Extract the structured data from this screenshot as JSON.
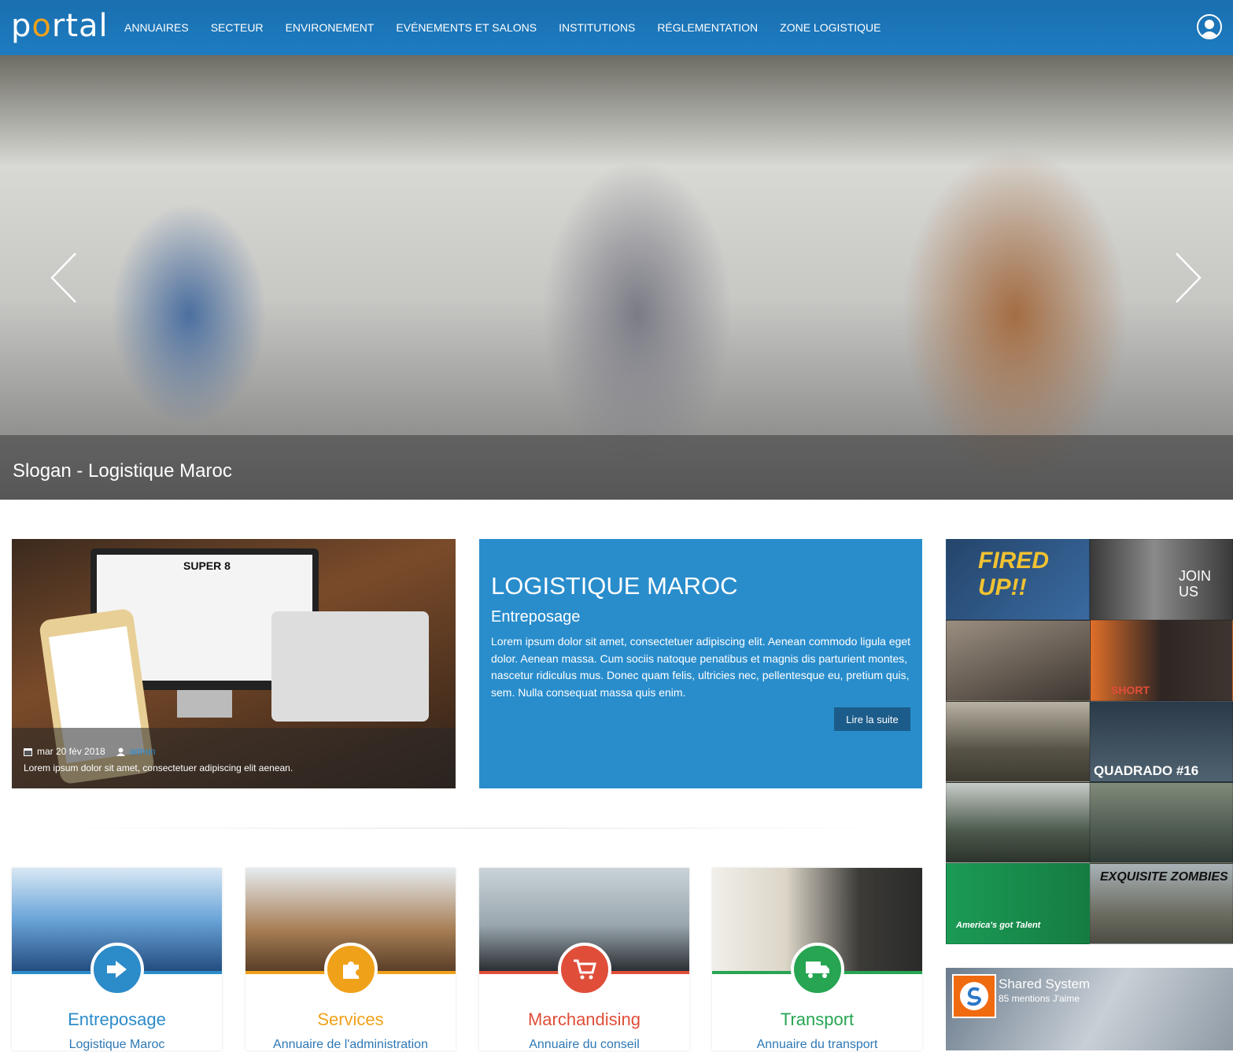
{
  "header": {
    "logo": "portal",
    "nav": [
      "ANNUAIRES",
      "SECTEUR",
      "ENVIRONEMENT",
      "EVÉNEMENTS ET SALONS",
      "INSTITUTIONS",
      "RÉGLEMENTATION",
      "ZONE LOGISTIQUE"
    ]
  },
  "hero": {
    "caption": "Slogan - Logistique Maroc"
  },
  "article": {
    "date": "mar 20 fév 2018",
    "author": "admin",
    "excerpt": "Lorem ipsum dolor sit amet, consectetuer adipiscing elit aenean.",
    "screen_title": "SUPER 8"
  },
  "feature": {
    "title": "LOGISTIQUE MAROC",
    "subtitle": "Entreposage",
    "body": "Lorem ipsum dolor sit amet, consectetuer adipiscing elit. Aenean commodo ligula eget dolor. Aenean massa. Cum sociis natoque penatibus et magnis dis parturient montes, nascetur ridiculus mus. Donec quam felis, ultricies nec, pellentesque eu, pretium quis, sem. Nulla consequat massa quis enim.",
    "button": "Lire la suite"
  },
  "services": [
    {
      "title": "Entreposage",
      "sub": "Logistique Maroc",
      "color": "#2c8bc9",
      "icon": "sign-in-icon"
    },
    {
      "title": "Services",
      "sub": "Annuaire de l'administration",
      "color": "#f0a11a",
      "icon": "puzzle-icon"
    },
    {
      "title": "Marchandising",
      "sub": "Annuaire du conseil",
      "color": "#e04e39",
      "icon": "cart-icon"
    },
    {
      "title": "Transport",
      "sub": "Annuaire du transport",
      "color": "#27a552",
      "icon": "truck-icon"
    }
  ],
  "videos": [
    "FIRED UP!!",
    "JOIN US",
    "",
    "SHORT",
    "",
    "QUADRADO #16",
    "",
    "",
    "America's got Talent",
    "EXQUISITE ZOMBIES"
  ],
  "fb": {
    "name": "Shared System",
    "likes": "85 mentions J'aime"
  }
}
